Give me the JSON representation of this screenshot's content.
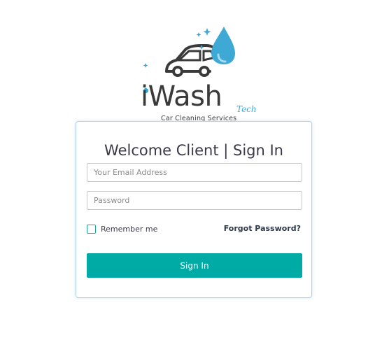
{
  "logo": {
    "brand_i": "i",
    "brand_rest": "Wash",
    "brand_suffix": "Tech",
    "tagline": "Car Cleaning Services"
  },
  "login": {
    "title": "Welcome Client | Sign In",
    "email_placeholder": "Your Email Address",
    "password_placeholder": "Password",
    "remember_label": "Remember me",
    "remember_checked": false,
    "forgot_label": "Forgot Password?",
    "submit_label": "Sign In"
  },
  "colors": {
    "accent": "#00aba6",
    "card_border": "#aad3ea",
    "logo_drop": "#3fa9d6",
    "logo_text": "#3a3a3a"
  }
}
